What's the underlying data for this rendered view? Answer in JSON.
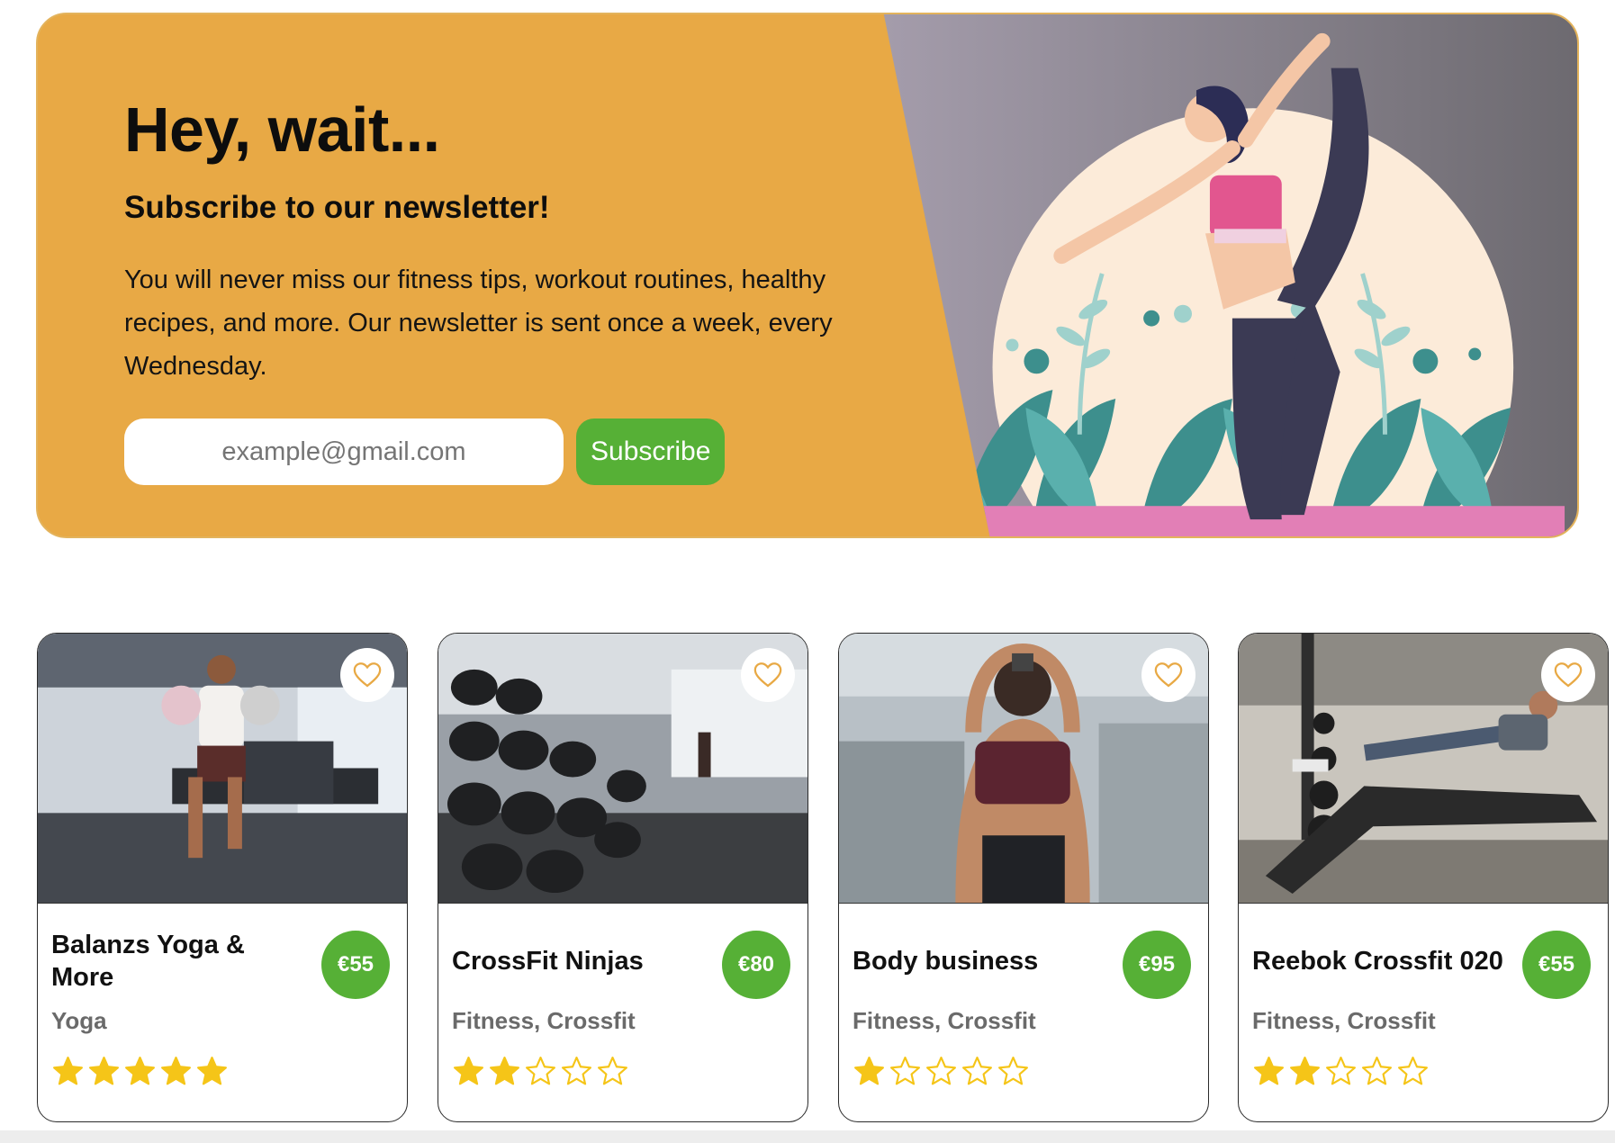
{
  "newsletter": {
    "title": "Hey, wait...",
    "subtitle": "Subscribe to our newsletter!",
    "description": "You will never miss our fitness tips, workout routines, healthy recipes, and more. Our newsletter is sent once a week, every Wednesday.",
    "email_placeholder": "example@gmail.com",
    "subscribe_label": "Subscribe",
    "colors": {
      "background": "#e8a945",
      "button": "#56b036",
      "illustration_bg": "#8c8791"
    }
  },
  "cards": [
    {
      "name": "Balanzs Yoga & More",
      "price": "€55",
      "category": "Yoga",
      "rating": 5,
      "icon": "heart-icon"
    },
    {
      "name": "CrossFit Ninjas",
      "price": "€80",
      "category": "Fitness, Crossfit",
      "rating": 2,
      "icon": "heart-icon"
    },
    {
      "name": "Body business",
      "price": "€95",
      "category": "Fitness, Crossfit",
      "rating": 1,
      "icon": "heart-icon"
    },
    {
      "name": "Reebok Crossfit 020",
      "price": "€55",
      "category": "Fitness, Crossfit",
      "rating": 2,
      "icon": "heart-icon"
    }
  ],
  "colors": {
    "price_badge": "#56b036",
    "star": "#f5c518",
    "heart": "#e8a945"
  }
}
